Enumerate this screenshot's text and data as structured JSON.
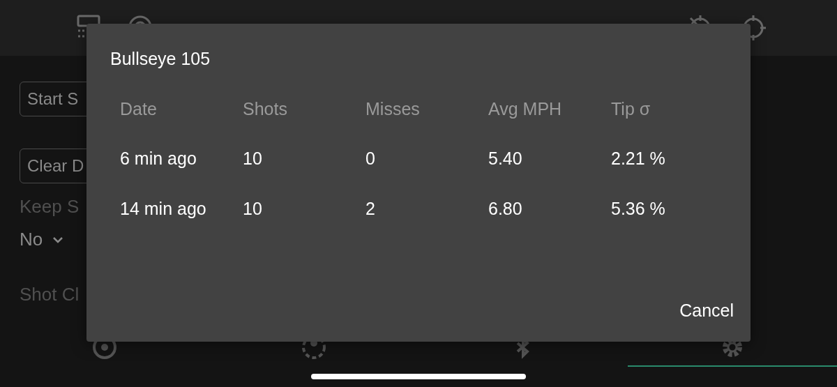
{
  "background": {
    "buttons": [
      "Start S",
      "Clear D"
    ],
    "keep_label": "Keep S",
    "keep_select": {
      "value": "No"
    },
    "shot_label": "Shot Cl"
  },
  "bottom_nav": {
    "tabs": [
      {
        "selected": false
      },
      {
        "selected": false
      },
      {
        "selected": false
      },
      {
        "selected": true
      }
    ]
  },
  "dialog": {
    "title": "Bullseye 105",
    "table": {
      "columns": [
        "Date",
        "Shots",
        "Misses",
        "Avg MPH",
        "Tip σ"
      ],
      "rows": [
        [
          "6 min ago",
          "10",
          "0",
          "5.40",
          "2.21 %"
        ],
        [
          "14 min ago",
          "10",
          "2",
          "6.80",
          "5.36 %"
        ]
      ]
    },
    "buttons": [
      "Cancel"
    ]
  }
}
